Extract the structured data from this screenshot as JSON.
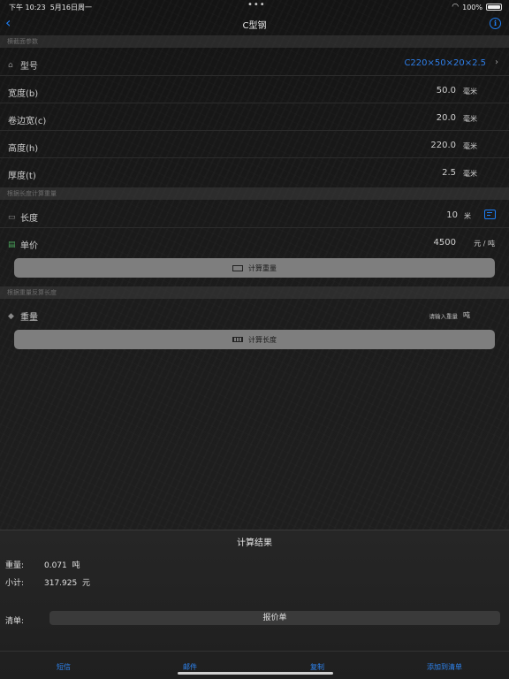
{
  "status": {
    "time": "下午 10:23",
    "date": "5月16日周一",
    "battery": "100%"
  },
  "nav": {
    "title": "C型钢"
  },
  "sections": {
    "spec": "横截面参数",
    "by_length": "根据长度计算重量",
    "by_weight": "根据重量反算长度"
  },
  "spec": {
    "model_label": "型号",
    "model_value": "C220×50×20×2.5",
    "width_label": "宽度(b)",
    "width_value": "50.0",
    "width_unit": "毫米",
    "lip_label": "卷边宽(c)",
    "lip_value": "20.0",
    "lip_unit": "毫米",
    "height_label": "高度(h)",
    "height_value": "220.0",
    "height_unit": "毫米",
    "thick_label": "厚度(t)",
    "thick_value": "2.5",
    "thick_unit": "毫米"
  },
  "length_calc": {
    "length_label": "长度",
    "length_value": "10",
    "length_unit": "米",
    "price_label": "单价",
    "price_value": "4500",
    "price_unit": "元 / 吨",
    "button": "计算重量"
  },
  "weight_calc": {
    "weight_label": "重量",
    "weight_placeholder": "请输入重量",
    "weight_unit": "吨",
    "button": "计算长度"
  },
  "result": {
    "title": "计算结果",
    "weight_key": "重量:",
    "weight_value": "0.071",
    "weight_unit": "吨",
    "subtotal_key": "小计:",
    "subtotal_value": "317.925",
    "subtotal_unit": "元",
    "list_key": "清单:",
    "quote_button": "报价单"
  },
  "toolbar": {
    "sms": "短信",
    "mail": "邮件",
    "copy": "复制",
    "add_list": "添加到清单"
  },
  "colors": {
    "accent": "#1e7ef5",
    "button_gray": "#7e7e7e"
  }
}
